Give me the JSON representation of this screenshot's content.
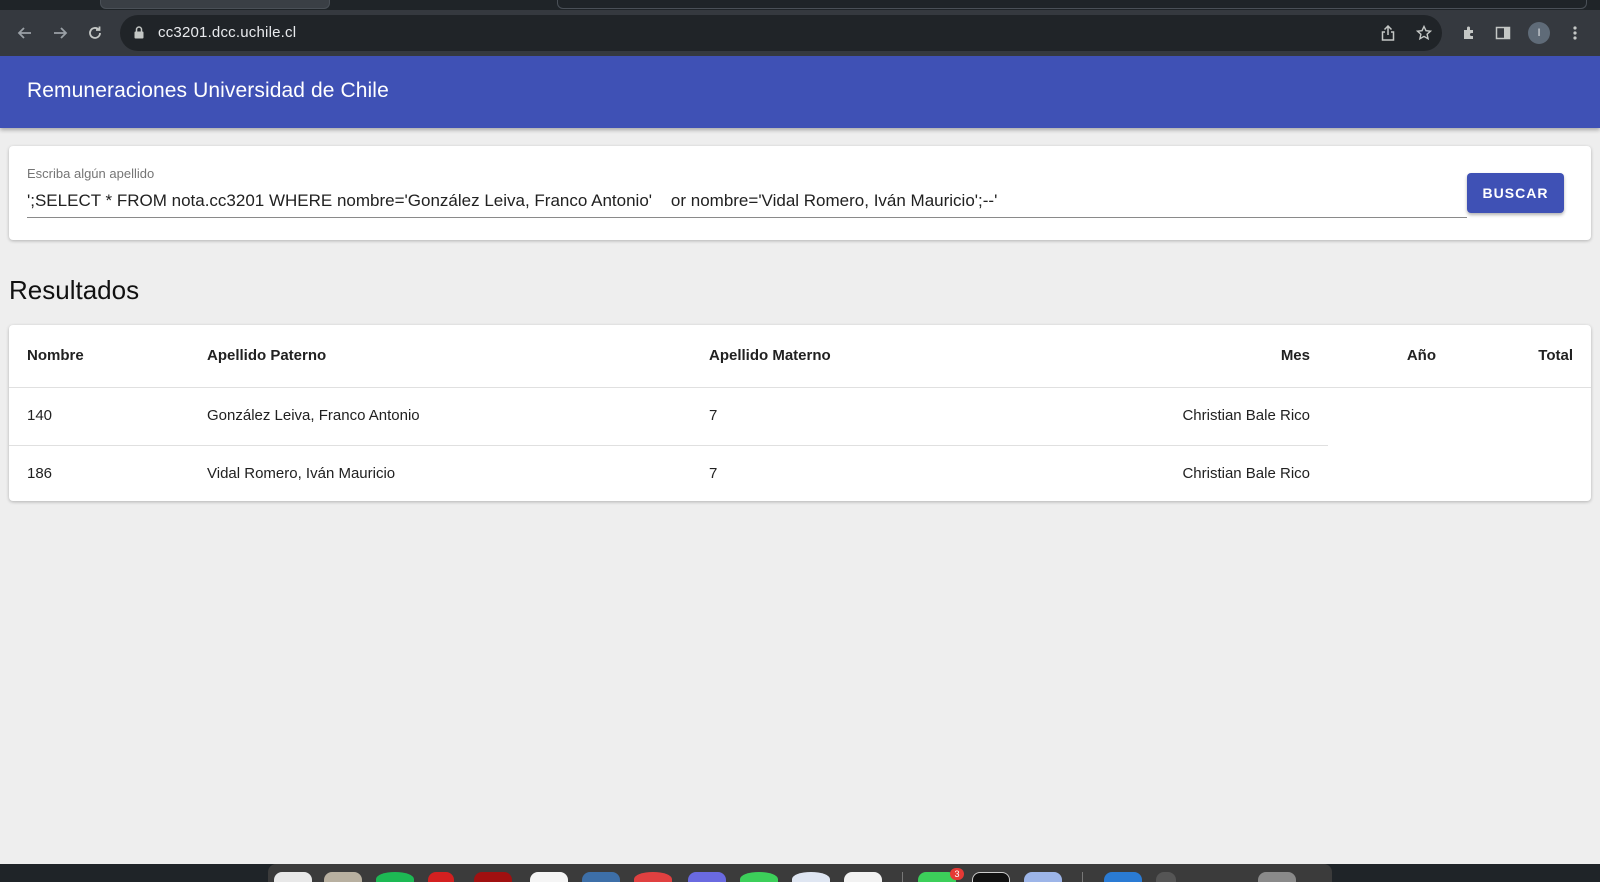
{
  "browser": {
    "url": "cc3201.dcc.uchile.cl",
    "profile_initial": "I",
    "icons": {
      "back": "arrow-left-icon",
      "forward": "arrow-right-icon",
      "reload": "reload-icon",
      "lock": "lock-icon",
      "share": "share-icon",
      "bookmark": "star-icon",
      "extensions": "puzzle-icon",
      "side_panel": "side-panel-icon",
      "menu": "kebab-menu-icon"
    }
  },
  "app": {
    "title": "Remuneraciones Universidad de Chile",
    "accent_color": "#3f51b5"
  },
  "search": {
    "label": "Escriba algún apellido",
    "value": "';SELECT * FROM nota.cc3201 WHERE nombre='González Leiva, Franco Antonio'    or nombre='Vidal Romero, Iván Mauricio';--'",
    "button_label": "BUSCAR"
  },
  "results": {
    "heading": "Resultados",
    "columns": [
      "Nombre",
      "Apellido Paterno",
      "Apellido Materno",
      "Mes",
      "Año",
      "Total"
    ],
    "rows": [
      [
        "140",
        "González Leiva, Franco Antonio",
        "7",
        "Christian Bale Rico",
        "",
        ""
      ],
      [
        "186",
        "Vidal Romero, Iván Mauricio",
        "7",
        "Christian Bale Rico",
        "",
        ""
      ]
    ]
  },
  "dock": {
    "messages_badge": "3"
  }
}
